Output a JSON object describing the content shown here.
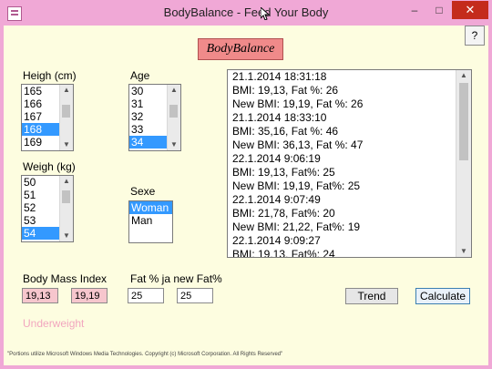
{
  "window": {
    "title": "BodyBalance - Feed Your Body",
    "controls": {
      "minimize": "–",
      "maximize": "□",
      "close": "✕"
    }
  },
  "help_label": "?",
  "logo_text": "BodyBalance",
  "height": {
    "label": "Heigh (cm)",
    "items": [
      "165",
      "166",
      "167",
      "168",
      "169"
    ],
    "selected": "168"
  },
  "age": {
    "label": "Age",
    "items": [
      "30",
      "31",
      "32",
      "33",
      "34"
    ],
    "selected": "34"
  },
  "weight": {
    "label": "Weigh (kg)",
    "items": [
      "50",
      "51",
      "52",
      "53",
      "54"
    ],
    "selected": "54"
  },
  "sex": {
    "label": "Sexe",
    "items": [
      "Woman",
      "Man"
    ],
    "selected": "Woman"
  },
  "history": [
    "21.1.2014 18:31:18",
    "BMI: 19,13, Fat %: 26",
    "New BMI: 19,19, Fat %: 26",
    "21.1.2014 18:33:10",
    "BMI: 35,16, Fat %: 46",
    "New BMI: 36,13, Fat %: 47",
    "22.1.2014 9:06:19",
    "BMI: 19,13, Fat%: 25",
    "New BMI: 19,19, Fat%: 25",
    "22.1.2014 9:07:49",
    "BMI: 21,78, Fat%: 20",
    "New BMI: 21,22, Fat%: 19",
    "22.1.2014 9:09:27",
    "BMI: 19,13, Fat%: 24"
  ],
  "bmi": {
    "label": "Body Mass Index",
    "value": "19,13",
    "new_value": "19,19"
  },
  "fat": {
    "label": "Fat % ja new Fat%",
    "value": "25",
    "new_value": "25"
  },
  "buttons": {
    "trend": "Trend",
    "calculate": "Calculate"
  },
  "status": "Underweight",
  "footer": "\"Portions utilize Microsoft Windows Media Technologies. Copyright (c) Microsoft Corporation. All Rights Reserved\"",
  "colors": {
    "frame": "#f0a8d6",
    "client_bg": "#fdfde0",
    "logo_bg": "#f08a8a",
    "selection": "#3399ff",
    "pink_field": "#f6c6cd",
    "status_text": "#f2a6bf"
  }
}
